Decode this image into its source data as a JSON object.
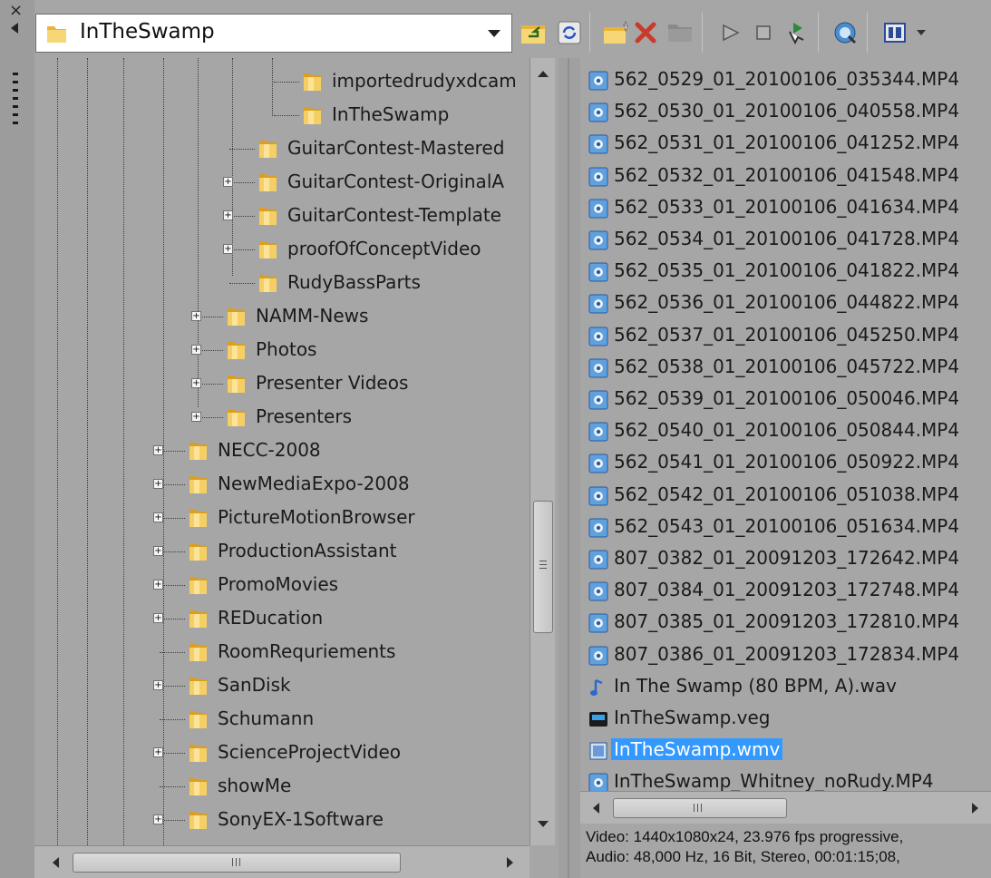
{
  "colors": {
    "panel_bg": "#a6a6a6",
    "selection": "#3399ff",
    "folder": "#f2c94c"
  },
  "toolbar": {
    "path_value": "InTheSwamp",
    "icons": [
      "up-folder-icon",
      "refresh-icon",
      "new-folder-icon",
      "delete-icon",
      "folder-icon",
      "play-icon",
      "stop-icon",
      "auto-preview-icon",
      "web-search-icon",
      "views-icon"
    ]
  },
  "tree": {
    "items": [
      {
        "label": "importedrudyxdcam"
      },
      {
        "label": "InTheSwamp"
      },
      {
        "label": "GuitarContest-Mastered"
      },
      {
        "label": "GuitarContest-OriginalA"
      },
      {
        "label": "GuitarContest-Template"
      },
      {
        "label": "proofOfConceptVideo"
      },
      {
        "label": "RudyBassParts"
      },
      {
        "label": "NAMM-News"
      },
      {
        "label": "Photos"
      },
      {
        "label": "Presenter Videos"
      },
      {
        "label": "Presenters"
      },
      {
        "label": "NECC-2008"
      },
      {
        "label": "NewMediaExpo-2008"
      },
      {
        "label": "PictureMotionBrowser"
      },
      {
        "label": "ProductionAssistant"
      },
      {
        "label": "PromoMovies"
      },
      {
        "label": "REDucation"
      },
      {
        "label": "RoomRequriements"
      },
      {
        "label": "SanDisk"
      },
      {
        "label": "Schumann"
      },
      {
        "label": "ScienceProjectVideo"
      },
      {
        "label": "showMe"
      },
      {
        "label": "SonyEX-1Software"
      }
    ]
  },
  "files": {
    "items": [
      {
        "name": "562_0529_01_20100106_035344.MP4",
        "type": "video"
      },
      {
        "name": "562_0530_01_20100106_040558.MP4",
        "type": "video"
      },
      {
        "name": "562_0531_01_20100106_041252.MP4",
        "type": "video"
      },
      {
        "name": "562_0532_01_20100106_041548.MP4",
        "type": "video"
      },
      {
        "name": "562_0533_01_20100106_041634.MP4",
        "type": "video"
      },
      {
        "name": "562_0534_01_20100106_041728.MP4",
        "type": "video"
      },
      {
        "name": "562_0535_01_20100106_041822.MP4",
        "type": "video"
      },
      {
        "name": "562_0536_01_20100106_044822.MP4",
        "type": "video"
      },
      {
        "name": "562_0537_01_20100106_045250.MP4",
        "type": "video"
      },
      {
        "name": "562_0538_01_20100106_045722.MP4",
        "type": "video"
      },
      {
        "name": "562_0539_01_20100106_050046.MP4",
        "type": "video"
      },
      {
        "name": "562_0540_01_20100106_050844.MP4",
        "type": "video"
      },
      {
        "name": "562_0541_01_20100106_050922.MP4",
        "type": "video"
      },
      {
        "name": "562_0542_01_20100106_051038.MP4",
        "type": "video"
      },
      {
        "name": "562_0543_01_20100106_051634.MP4",
        "type": "video"
      },
      {
        "name": "807_0382_01_20091203_172642.MP4",
        "type": "video"
      },
      {
        "name": "807_0384_01_20091203_172748.MP4",
        "type": "video"
      },
      {
        "name": "807_0385_01_20091203_172810.MP4",
        "type": "video"
      },
      {
        "name": "807_0386_01_20091203_172834.MP4",
        "type": "video"
      },
      {
        "name": "In The Swamp (80 BPM, A).wav",
        "type": "audio"
      },
      {
        "name": "InTheSwamp.veg",
        "type": "project"
      },
      {
        "name": "InTheSwamp.wmv",
        "type": "wmv",
        "selected": true
      },
      {
        "name": "InTheSwamp_Whitney_noRudy.MP4",
        "type": "video"
      }
    ]
  },
  "status": {
    "video": "Video: 1440x1080x24, 23.976 fps progressive,",
    "audio": "Audio: 48,000 Hz, 16 Bit, Stereo, 00:01:15;08,"
  }
}
